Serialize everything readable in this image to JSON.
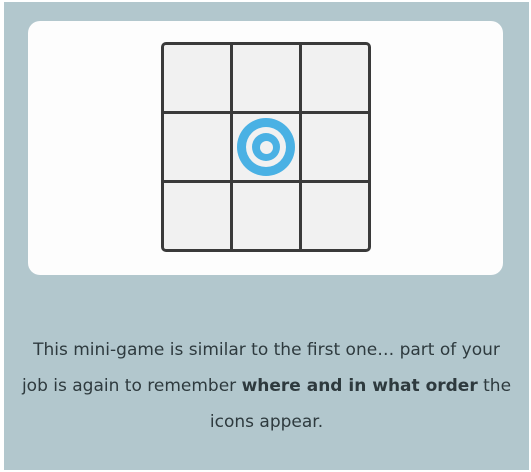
{
  "board": {
    "rows": 3,
    "cols": 3,
    "active_icon": "target-icon",
    "active_row": 2,
    "active_col": 2
  },
  "caption": {
    "part1": "This mini-game is similar to the first one… part of your job is again to remember ",
    "bold": "where and in what order",
    "part2": " the icons appear."
  },
  "colors": {
    "panel": "#b2c7cd",
    "card": "#fdfdfd",
    "cell": "#f1f1f1",
    "grid_line": "#3a3a3a",
    "icon": "#4ab1e4",
    "text": "#2e3a3e"
  }
}
